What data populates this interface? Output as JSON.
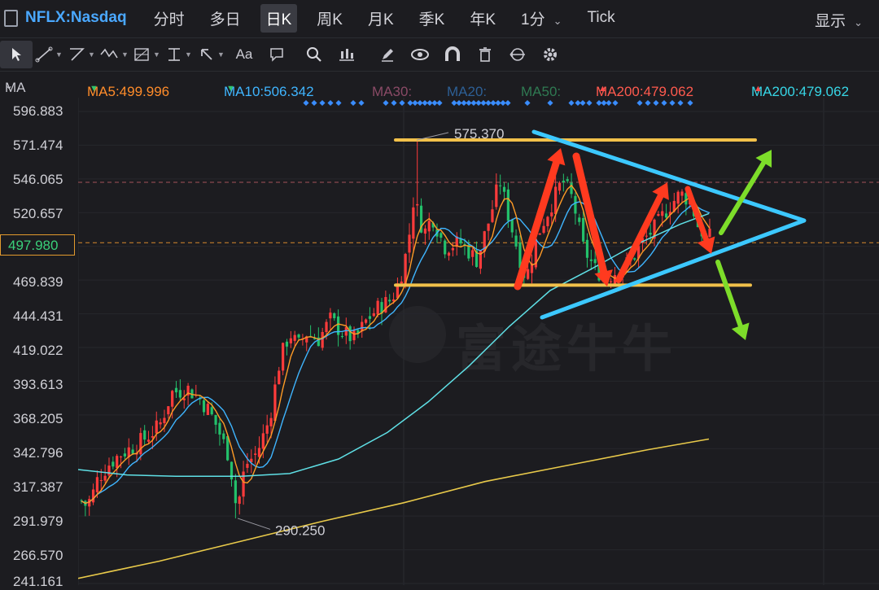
{
  "header": {
    "symbol": "NFLX:Nasdaq",
    "tabs": [
      "分时",
      "多日",
      "日K",
      "周K",
      "月K",
      "季K",
      "年K",
      "1分",
      "Tick"
    ],
    "active_tab": "日K",
    "display_label": "显示"
  },
  "toolbar": {
    "tools": [
      "cursor-icon",
      "line-icon",
      "polyline-icon",
      "wave-icon",
      "fib-icon",
      "price-line-icon",
      "arrow-icon",
      "text-icon",
      "note-icon",
      "search-icon",
      "chart-settings-icon",
      "pen-icon",
      "eye-icon",
      "magnet-icon",
      "trash-icon",
      "sync-icon",
      "gear-icon"
    ],
    "text_tool_label": "Aa"
  },
  "ma_bar": {
    "label": "MA",
    "items": [
      {
        "text": "MA5:499.996",
        "color": "#ff8c2a",
        "trend": "down"
      },
      {
        "text": "MA10:506.342",
        "color": "#3fb5ff",
        "trend": "down"
      },
      {
        "text": "MA30:",
        "color": "#8a4a66",
        "trend": ""
      },
      {
        "text": "MA20:",
        "color": "#2d5f95",
        "trend": ""
      },
      {
        "text": "MA50:",
        "color": "#2f7a52",
        "trend": ""
      },
      {
        "text": "MA200:479.062",
        "color": "#ff5a4e",
        "trend": "up"
      },
      {
        "text": "MA200:479.062",
        "color": "#37d6e6",
        "trend": "up"
      }
    ]
  },
  "watermark": "富途牛牛",
  "chart_data": {
    "type": "candlestick",
    "symbol": "NFLX",
    "y_ticks": [
      "596.883",
      "571.474",
      "546.065",
      "520.657",
      "497.980",
      "469.839",
      "444.431",
      "419.022",
      "393.613",
      "368.205",
      "342.796",
      "317.387",
      "291.979",
      "266.570",
      "241.161"
    ],
    "current_price": "497.980",
    "ylim": [
      241.161,
      596.883
    ],
    "annotations": {
      "high": "575.370",
      "low": "290.250"
    },
    "resistance": 575.4,
    "support": 466.0,
    "ma5_last": 499.996,
    "ma10_last": 506.342,
    "ma200_last": 479.062,
    "colors": {
      "up": "#ff3b3b",
      "down": "#23c16b",
      "ma5": "#ff9b26",
      "ma10": "#3fb5ff",
      "ma_cyan": "#5fe0e6",
      "ma_yellow": "#e8c94a",
      "pattern": "#3cc8ff",
      "arrow_red": "#ff3a1f",
      "arrow_green": "#7ddd2a",
      "hline": "#f2c14a"
    }
  }
}
